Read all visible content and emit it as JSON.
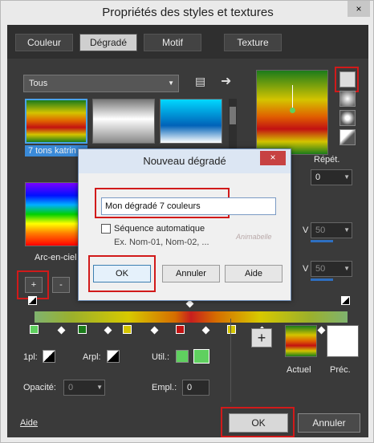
{
  "window": {
    "title": "Propriétés des styles et textures",
    "close": "×"
  },
  "tabs": [
    "Couleur",
    "Dégradé",
    "Motif",
    "Texture"
  ],
  "category": {
    "selected": "Tous"
  },
  "gradients": [
    {
      "label": "7 tons katrin"
    },
    {
      "label": ""
    },
    {
      "label": ""
    },
    {
      "label": "Arc-en-ciel"
    }
  ],
  "add_btn": "+",
  "remove_btn": "-",
  "repeat": {
    "label": "Répét.",
    "value": "0"
  },
  "angle_row": {
    "v_label": "V",
    "value1": "50",
    "value2": "50"
  },
  "stops_panel": {
    "left_label": "1pl:",
    "right_label": "Arpl:",
    "util_label": "Util.:",
    "opacity_label": "Opacité:",
    "opacity_value": "0",
    "location_label": "Empl.:",
    "location_value": "0"
  },
  "preview": {
    "current_label": "Actuel",
    "previous_label": "Préc.",
    "plus": "+"
  },
  "footer": {
    "help": "Aide",
    "ok": "OK",
    "cancel": "Annuler"
  },
  "dialog": {
    "title": "Nouveau dégradé",
    "close": "×",
    "name_value": "Mon dégradé 7 couleurs",
    "auto_seq_label": "Séquence automatique",
    "example": "Ex. Nom-01, Nom-02, ...",
    "ok": "OK",
    "cancel": "Annuler",
    "help": "Aide"
  },
  "watermark": "Animabelle",
  "colors": {
    "accent_red": "#d11a1a",
    "dark_bg": "#3a3a3a",
    "blue_bar": "#2e6fc1"
  }
}
